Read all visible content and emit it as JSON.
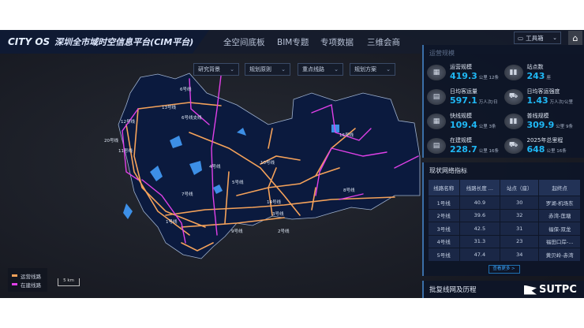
{
  "header": {
    "logo": "CITY OS",
    "title": "深圳全市域时空信息平台(CIM平台)",
    "nav": [
      "全空间底板",
      "BIM专题",
      "专项数据",
      "三维会商"
    ],
    "toolbox": "工具箱"
  },
  "filters": [
    "研究背景",
    "规划原则",
    "重点线路",
    "规划方案"
  ],
  "ops": {
    "title": "运营规模",
    "stats": [
      {
        "label": "运营规模",
        "value": "419.3",
        "unit": "公里 12条",
        "icon": "building-icon"
      },
      {
        "label": "站点数",
        "value": "243",
        "unit": "座",
        "icon": "station-icon"
      },
      {
        "label": "日均客运量",
        "value": "597.1",
        "unit": "万人次/日",
        "icon": "folder-icon"
      },
      {
        "label": "日均客运强度",
        "value": "1.43",
        "unit": "万人次/公里",
        "icon": "train-icon"
      },
      {
        "label": "快线规模",
        "value": "109.4",
        "unit": "公里 3条",
        "icon": "building-icon"
      },
      {
        "label": "普线规模",
        "value": "309.9",
        "unit": "公里 9条",
        "icon": "station-icon"
      },
      {
        "label": "在建规模",
        "value": "228.7",
        "unit": "公里 16条",
        "icon": "folder-icon"
      },
      {
        "label": "2025年总里程",
        "value": "648",
        "unit": "公里 16条",
        "icon": "train-icon"
      }
    ]
  },
  "network": {
    "title": "现状网络指标",
    "columns": [
      "线路名称",
      "线路长度 ...",
      "站点（座）",
      "起终点"
    ],
    "rows": [
      [
        "1号线",
        "40.9",
        "30",
        "罗湖-机场东"
      ],
      [
        "2号线",
        "39.6",
        "32",
        "赤湾-莲塘"
      ],
      [
        "3号线",
        "42.5",
        "31",
        "福保-双龙"
      ],
      [
        "4号线",
        "31.3",
        "23",
        "福田口岸-..."
      ],
      [
        "5号线",
        "47.4",
        "34",
        "黄贝岭-赤湾"
      ]
    ],
    "more": "查看更多 >"
  },
  "history": {
    "title": "批复线网及历程"
  },
  "brand": "SUTPC",
  "legend": [
    {
      "label": "运营线路",
      "color": "#f5a25a"
    },
    {
      "label": "在建线路",
      "color": "#e040e8"
    }
  ],
  "scale": "5 km",
  "map_labels": [
    "6号线",
    "13号线",
    "6号线支线",
    "12号线",
    "20号线",
    "11号线",
    "4号线",
    "5号线",
    "10号线",
    "14号线",
    "3号线",
    "2号线",
    "1号线",
    "7号线",
    "9号线",
    "16号线",
    "8号线"
  ],
  "colors": {
    "operating": "#f5a25a",
    "construction": "#e040e8",
    "accent": "#1fb8f5"
  }
}
